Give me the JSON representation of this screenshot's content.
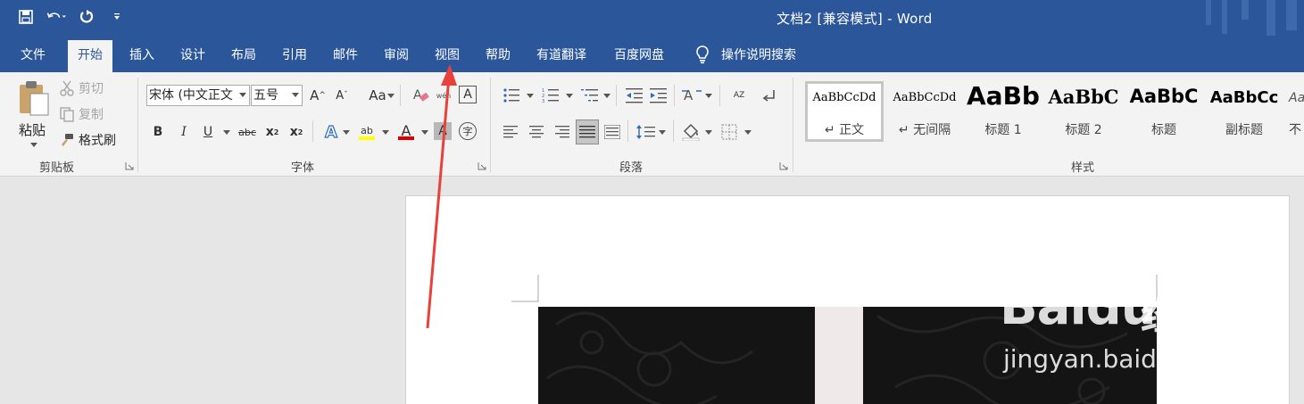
{
  "window": {
    "title": "文档2 [兼容模式] - Word"
  },
  "tabs": [
    "文件",
    "开始",
    "插入",
    "设计",
    "布局",
    "引用",
    "邮件",
    "审阅",
    "视图",
    "帮助",
    "有道翻译",
    "百度网盘"
  ],
  "active_tab": "开始",
  "tell_me": "操作说明搜索",
  "clipboard": {
    "paste": "粘贴",
    "cut": "剪切",
    "copy": "复制",
    "format_painter": "格式刷",
    "label": "剪贴板"
  },
  "font": {
    "name": "宋体 (中文正文",
    "size": "五号",
    "label": "字体",
    "grow": "A",
    "shrink": "A",
    "case": "Aa",
    "bold": "B",
    "italic": "I",
    "underline": "U",
    "strike": "abc",
    "subscript": "x",
    "superscript": "x",
    "sub_mark": "2",
    "sup_mark": "2",
    "text_effect": "A",
    "highlight": "ab",
    "font_color": "A",
    "char_shade": "A",
    "enclose": "字",
    "border": "A",
    "phonetic": "wén"
  },
  "paragraph": {
    "label": "段落",
    "sort": "AZ"
  },
  "styles": {
    "label": "样式",
    "items": [
      {
        "sample": "AaBbCcDd",
        "name": "↵ 正文"
      },
      {
        "sample": "AaBbCcDd",
        "name": "↵ 无间隔"
      },
      {
        "sample": "AaBb",
        "name": "标题 1"
      },
      {
        "sample": "AaBbC",
        "name": "标题 2"
      },
      {
        "sample": "AaBbC",
        "name": "标题"
      },
      {
        "sample": "AaBbCc",
        "name": "副标题"
      },
      {
        "sample": "Aa",
        "name": "不"
      }
    ]
  },
  "watermark": {
    "brand": "Baidu",
    "product": "经验",
    "url": "jingyan.baidu.com"
  },
  "colors": {
    "titlebar": "#2b579a",
    "ribbon": "#f3f3f3",
    "highlight": "#ffff00",
    "font_color": "#e00000",
    "annotation": "#e8403a"
  }
}
